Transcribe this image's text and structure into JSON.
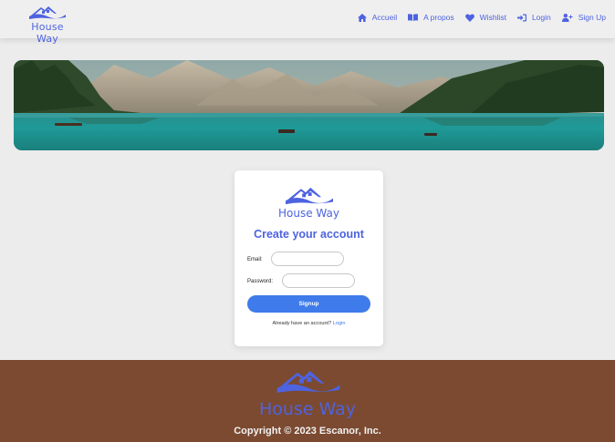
{
  "brand": {
    "name": "House Way"
  },
  "nav": {
    "items": [
      {
        "label": "Accueil",
        "icon": "home-icon"
      },
      {
        "label": "A propos",
        "icon": "book-icon"
      },
      {
        "label": "Wishlist",
        "icon": "heart-icon"
      },
      {
        "label": "Login",
        "icon": "login-icon"
      },
      {
        "label": "Sign Up",
        "icon": "user-plus-icon"
      }
    ]
  },
  "hero": {
    "image": "mountain-lake-banner"
  },
  "form": {
    "brand": "House Way",
    "title": "Create your account",
    "email_label": "Email:",
    "email_value": "",
    "password_label": "Password:",
    "password_value": "",
    "submit_label": "Signup",
    "login_prompt": "Already have an account?",
    "login_link": "Login"
  },
  "footer": {
    "brand": "House Way",
    "copyright": "Copyright © 2023 Escanor, Inc."
  },
  "colors": {
    "accent": "#4d63e0",
    "button": "#3f7bea",
    "footer_bg": "#7b4a31",
    "page_bg": "#ececec"
  }
}
